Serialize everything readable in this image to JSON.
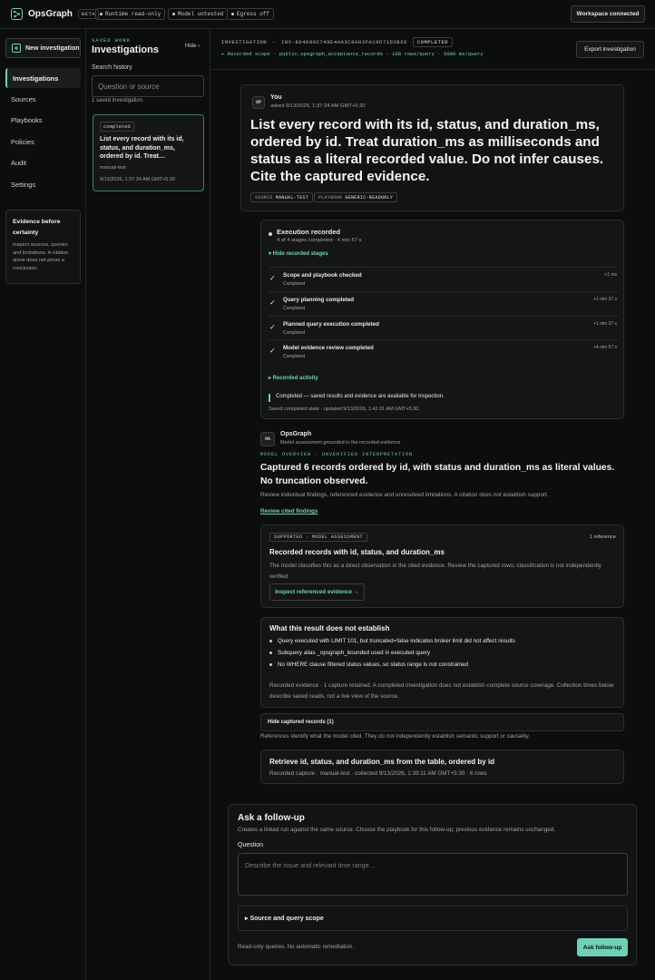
{
  "app": {
    "name": "OpsGraph",
    "beta": "BETA",
    "pills": [
      "Runtime read-only",
      "Model untested",
      "Egress off"
    ],
    "workspace_status": "Workspace connected"
  },
  "nav": {
    "new_investigation": "New investigation",
    "items": [
      "Investigations",
      "Sources",
      "Playbooks",
      "Policies",
      "Audit",
      "Settings"
    ],
    "active": "Investigations",
    "evidence_card": {
      "title": "Evidence before certainty",
      "body": "Inspect sources, queries and limitations. A citation alone does not prove a conclusion."
    }
  },
  "saved": {
    "kicker": "SAVED WORK",
    "title": "Investigations",
    "hide": "Hide ‹",
    "search_label": "Search history",
    "search_placeholder": "Question or source",
    "count_text": "1 saved investigation.",
    "card": {
      "status": "completed",
      "question": "List every record with its id, status, and duration_ms, ordered by id. Treat…",
      "source": "manual-test",
      "timestamp": "9/13/2026, 1:37:34 AM GMT+5:30"
    }
  },
  "header": {
    "inv_label": "INVESTIGATION",
    "inv_sep": "·",
    "inv_id": "INV-864D80C749E4AA3C9A83FA19D71D2B26",
    "status": "COMPLETED",
    "scope": "▸ Recorded scope · public.opsgraph_acceptance_records · 100 rows/query · 5000 ms/query",
    "export": "Export investigation"
  },
  "user_msg": {
    "avatar": "OP",
    "who": "You",
    "asked": "asked 9/13/2026, 1:37:34 AM GMT+5:30",
    "text": "List every record with its id, status, and duration_ms, ordered by id. Treat duration_ms as milliseconds and status as a literal recorded value. Do not infer causes. Cite the captured evidence.",
    "tags": [
      {
        "k": "SOURCE",
        "v": "MANUAL-TEST"
      },
      {
        "k": "PLAYBOOK",
        "v": "GENERIC-READONLY"
      }
    ]
  },
  "execution": {
    "title": "Execution recorded",
    "sub": "4 of 4 stages completed · 4 min 57 s",
    "toggle": "▾ Hide recorded stages",
    "stages": [
      {
        "name": "Scope and playbook checked",
        "status": "Completed",
        "time": "+1 ms"
      },
      {
        "name": "Query planning completed",
        "status": "Completed",
        "time": "+1 min 37 s"
      },
      {
        "name": "Planned query execution completed",
        "status": "Completed",
        "time": "+1 min 37 s"
      },
      {
        "name": "Model evidence review completed",
        "status": "Completed",
        "time": "+4 min 57 s"
      }
    ],
    "activity": "▸ Recorded activity",
    "done": "Completed — saved results and evidence are available for inspection.",
    "saved": "Saved completed state · updated 9/13/2026, 1:42:31 AM GMT+5:30."
  },
  "assistant": {
    "avatar": "OG",
    "name": "OpsGraph",
    "sub": "Model assessment grounded in the recorded evidence",
    "kicker": "MODEL OVERVIEW · UNVERIFIED INTERPRETATION",
    "answer": "Captured 6 records ordered by id, with status and duration_ms as literal values. No truncation observed.",
    "answer_sub": "Review individual findings, referenced evidence and unresolved limitations. A citation does not establish support.",
    "cited_link": "Review cited findings",
    "finding": {
      "badge": "SUPPORTED · MODEL ASSESSMENT",
      "refs": "1 reference",
      "title": "Recorded records with id, status, and duration_ms",
      "body": "The model classifies this as a direct observation in the cited evidence. Review the captured rows; classification is not independently verified.",
      "button": "Inspect referenced evidence →"
    },
    "limits": {
      "title": "What this result does not establish",
      "items": [
        "Query executed with LIMIT 101, but truncated=false indicates broker limit did not affect results",
        "Subquery alias _opsgraph_bounded used in executed query",
        "No WHERE clause filtered status values, so status range is not constrained"
      ],
      "note": "Recorded evidence · 1 capture retained. A completed investigation does not establish complete source coverage. Collection times below describe saved reads, not a live view of the source."
    },
    "hide_captured": "Hide captured records (1)",
    "refs_note": "References identify what the model cited. They do not independently establish semantic support or causality.",
    "capture": {
      "title": "Retrieve id, status, and duration_ms from the table, ordered by id",
      "meta": "Recorded capture · manual-test · collected 9/13/2026, 1:39:11 AM GMT+5:30 · 6 rows"
    }
  },
  "followup": {
    "title": "Ask a follow-up",
    "sub": "Creates a linked run against the same source. Choose the playbook for this follow-up; previous evidence remains unchanged.",
    "question_label": "Question",
    "placeholder": "Describe the issue and relevant time range…",
    "scope": "▸ Source and query scope",
    "readonly": "Read-only queries. No automatic remediation.",
    "ask": "Ask follow-up"
  },
  "colors": {
    "accent": "#6fd1b4",
    "background": "#0c0d0e",
    "card": "#141516"
  }
}
